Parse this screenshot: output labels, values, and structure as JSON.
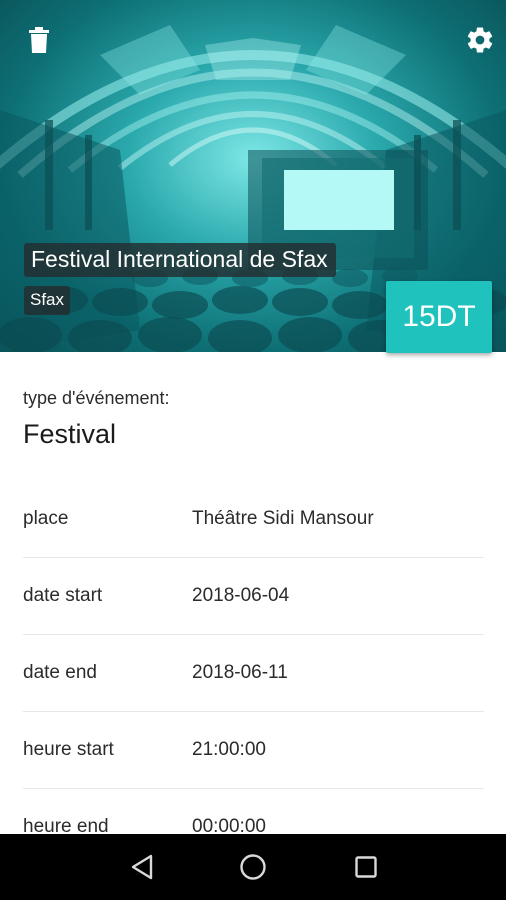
{
  "event": {
    "title": "Festival International de Sfax",
    "city": "Sfax",
    "price": "15DT"
  },
  "details": {
    "type_label": "type d'événement:",
    "type_value": "Festival",
    "rows": [
      {
        "key": "place",
        "value": "Théâtre Sidi Mansour"
      },
      {
        "key": "date start",
        "value": "2018-06-04"
      },
      {
        "key": "date end",
        "value": "2018-06-11"
      },
      {
        "key": "heure start",
        "value": "21:00:00"
      },
      {
        "key": "heure end",
        "value": "00:00:00"
      }
    ]
  },
  "icons": {
    "delete": "trash-icon",
    "settings": "gear-icon",
    "back": "back-triangle-icon",
    "home": "home-circle-icon",
    "recents": "recents-square-icon"
  },
  "colors": {
    "accent": "#20c2bd",
    "hero_tint": "#2aa9ad",
    "chip_bg": "#232d30",
    "navbar": "#000000",
    "divider": "#e7e7e7"
  }
}
